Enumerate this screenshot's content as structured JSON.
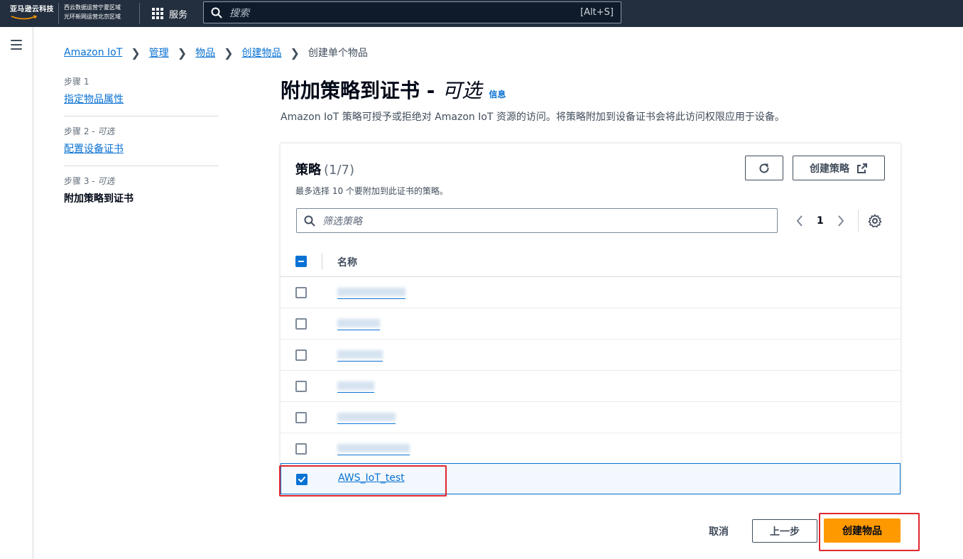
{
  "topnav": {
    "logo_text": "亚马逊云科技",
    "region_line1": "西云数据运营宁夏区域",
    "region_line2": "光环新网运营北京区域",
    "services_label": "服务",
    "search_placeholder": "搜索",
    "search_shortcut": "[Alt+S]"
  },
  "breadcrumb": {
    "items": [
      "Amazon IoT",
      "管理",
      "物品",
      "创建物品"
    ],
    "current": "创建单个物品"
  },
  "steps": [
    {
      "label": "步骤 1",
      "optional": "",
      "title": "指定物品属性"
    },
    {
      "label": "步骤 2 - ",
      "optional": "可选",
      "title": "配置设备证书"
    },
    {
      "label": "步骤 3 - ",
      "optional": "可选",
      "title": "附加策略到证书"
    }
  ],
  "header": {
    "title": "附加策略到证书 -",
    "optional": "可选",
    "info": "信息",
    "description": "Amazon IoT 策略可授予或拒绝对 Amazon IoT 资源的访问。将策略附加到设备证书会将此访问权限应用于设备。"
  },
  "panel": {
    "title": "策略",
    "count": "(1/7)",
    "subtitle": "最多选择 10 个要附加到此证书的策略。",
    "create_policy_label": "创建策略",
    "filter_placeholder": "筛选策略",
    "page_number": "1",
    "column_name": "名称",
    "selected_policy": "AWS_IoT_test"
  },
  "footer": {
    "cancel_label": "取消",
    "prev_label": "上一步",
    "create_label": "创建物品"
  },
  "colors": {
    "nav_bg": "#232f3e",
    "link": "#0972d3",
    "primary_button": "#ff9900",
    "highlight": "#e0272f"
  }
}
